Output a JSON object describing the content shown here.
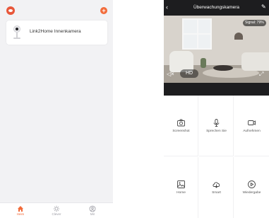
{
  "left_screen": {
    "device": {
      "name": "Link2Home Innenkamera"
    },
    "tabs": [
      {
        "label": "Heim",
        "icon": "home-icon",
        "active": true
      },
      {
        "label": "Clever",
        "icon": "smart-icon",
        "active": false
      },
      {
        "label": "Mir",
        "icon": "me-icon",
        "active": false
      }
    ],
    "colors": {
      "accent": "#f26b3a",
      "background": "#f2f2f4"
    }
  },
  "right_screen": {
    "title": "Überwachungskamera",
    "signal": "Signal: 79%",
    "quality_label": "HD",
    "actions": [
      {
        "label": "Screenshot",
        "icon": "camera-icon"
      },
      {
        "label": "Sprechen Sie",
        "icon": "microphone-icon"
      },
      {
        "label": "Aufnehmen",
        "icon": "video-record-icon"
      },
      {
        "label": "Home",
        "icon": "image-icon"
      },
      {
        "label": "Smart",
        "icon": "cloud-icon"
      },
      {
        "label": "Wiedergabe",
        "icon": "playback-icon"
      }
    ]
  }
}
